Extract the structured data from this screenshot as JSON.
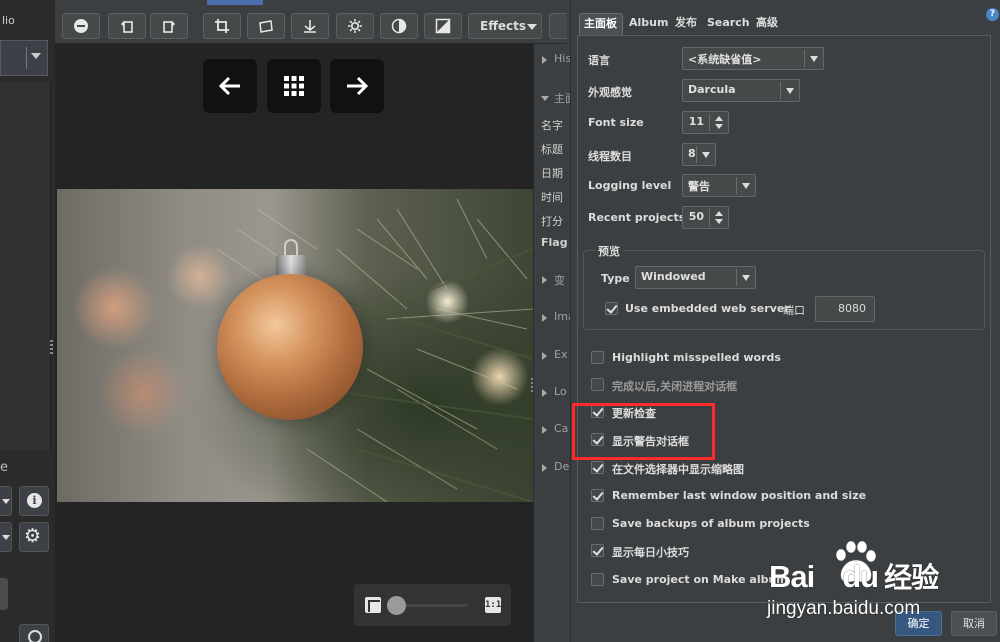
{
  "left_panel": {
    "title": "lio",
    "label": "e"
  },
  "toolbar": {
    "effects_label": "Effects",
    "buttons": [
      "remove-icon",
      "rotate-left-icon",
      "rotate-right-icon",
      "crop-icon",
      "straighten-icon",
      "levels-icon",
      "settings-icon",
      "contrast-icon",
      "exposure-icon"
    ]
  },
  "viewer": {
    "nav": [
      "previous-arrow-icon",
      "grid-icon",
      "next-arrow-icon"
    ],
    "zoom_one_to_one": "1:1"
  },
  "info_strip": {
    "sections_top": [
      "His",
      "主面"
    ],
    "fields": [
      "名字",
      "标题",
      "日期",
      "时间",
      "打分",
      "Flag"
    ],
    "sections_bottom": [
      "变",
      "Ima",
      "Ex",
      "Lo",
      "Ca",
      "De"
    ]
  },
  "prefs": {
    "tabs": [
      "主面板",
      "Album",
      "发布",
      "Search",
      "高级"
    ],
    "active_tab": "主面板",
    "language_label": "语言",
    "language_value": "<系统缺省值>",
    "lookandfeel_label": "外观感觉",
    "lookandfeel_value": "Darcula",
    "fontsize_label": "Font size",
    "fontsize_value": "11",
    "threads_label": "线程数目",
    "threads_value": "8",
    "logging_label": "Logging level",
    "logging_value": "警告",
    "recent_label": "Recent projects",
    "recent_value": "50",
    "preview_group": "预览",
    "type_label": "Type",
    "type_value": "Windowed",
    "webserver_label": "Use embedded web server",
    "webserver_checked": true,
    "port_label": "端口",
    "port_value": "8080",
    "checkboxes": [
      {
        "label": "Highlight misspelled words",
        "checked": false,
        "dim": false
      },
      {
        "label": "完成以后,关闭进程对话框",
        "checked": false,
        "dim": true
      },
      {
        "label": "更新检查",
        "checked": true,
        "dim": false
      },
      {
        "label": "显示警告对话框",
        "checked": true,
        "dim": false
      },
      {
        "label": "在文件选择器中显示缩略图",
        "checked": true,
        "dim": false
      },
      {
        "label": "Remember last window position and size",
        "checked": true,
        "dim": false
      },
      {
        "label": "Save backups of album projects",
        "checked": false,
        "dim": false
      },
      {
        "label": "显示每日小技巧",
        "checked": true,
        "dim": false
      },
      {
        "label": "Save project on Make album",
        "checked": false,
        "dim": false
      }
    ],
    "ok_label": "确定",
    "cancel_label": "取消"
  },
  "watermark": {
    "brand": "Bai",
    "brand2": "du",
    "cn": "经验",
    "url": "jingyan.baidu.com"
  },
  "colors": {
    "accent": "#4b6eaf",
    "highlight": "#ff2b2b",
    "ok_button": "#365880"
  }
}
